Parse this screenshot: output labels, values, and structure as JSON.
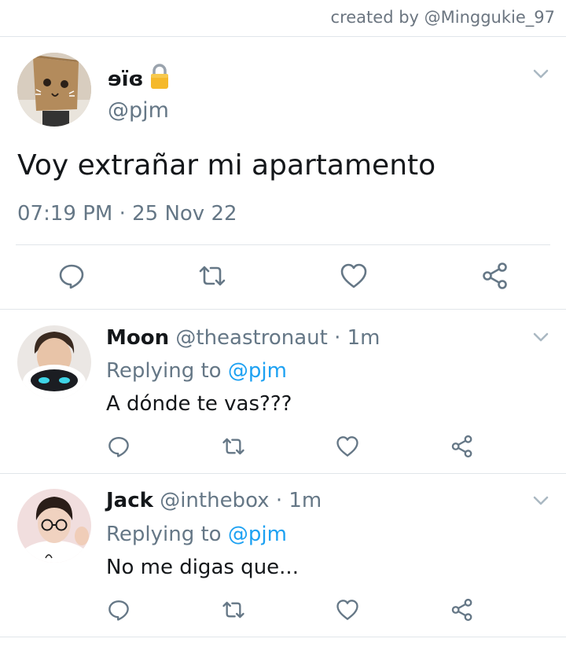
{
  "credit": "created by @Minggukie_97",
  "main_tweet": {
    "name": "ɘïɞ",
    "lock_icon": "lock-icon",
    "handle": "@pjm",
    "text": "Voy extrañar mi apartamento",
    "timestamp": "07:19 PM · 25 Nov 22",
    "actions": [
      "reply-icon",
      "retweet-icon",
      "like-icon",
      "share-icon"
    ]
  },
  "replies": [
    {
      "name": "Moon",
      "handle": "@theastronaut",
      "time": "· 1m",
      "replying_prefix": "Replying to",
      "replying_to": "@pjm",
      "text": "A dónde te vas???"
    },
    {
      "name": "Jack",
      "handle": "@inthebox",
      "time": "· 1m",
      "replying_prefix": "Replying to",
      "replying_to": "@pjm",
      "text": "No me digas que..."
    }
  ],
  "colors": {
    "link": "#1da1f2",
    "secondary_text": "#657786",
    "primary_text": "#14171a",
    "divider": "#e1e6ea"
  }
}
